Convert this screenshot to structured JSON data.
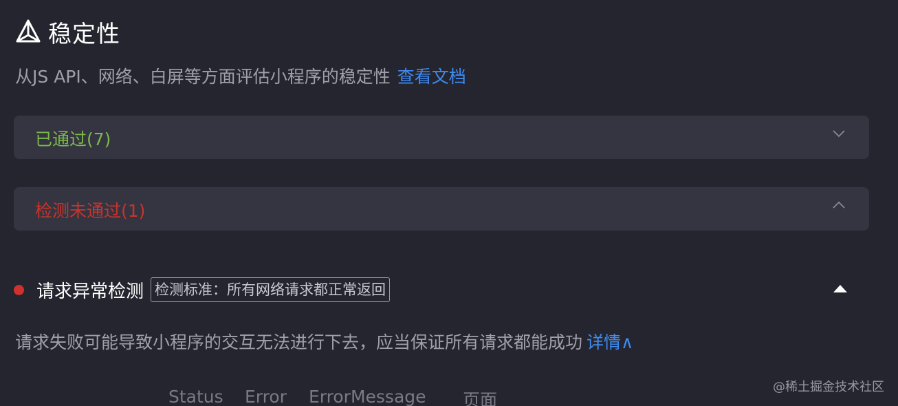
{
  "section": {
    "title": "稳定性",
    "icon": "stability-icon",
    "description": "从JS API、网络、白屏等方面评估小程序的稳定性",
    "doc_link": "查看文档"
  },
  "panels": {
    "passed_label": "已通过(7)",
    "failed_label": "检测未通过(1)"
  },
  "check": {
    "title": "请求异常检测",
    "standard": "检测标准：所有网络请求都正常返回",
    "description": "请求失败可能导致小程序的交互无法进行下去，应当保证所有请求都能成功",
    "detail_link": "详情∧"
  },
  "table": {
    "columns": [
      "Status",
      "Error",
      "ErrorMessage",
      "页面"
    ]
  },
  "watermark": "@稀土掘金技术社区",
  "colors": {
    "background": "#25252f",
    "panel": "#353542",
    "pass": "#7cb84a",
    "fail": "#c8342c",
    "link": "#3f8cf2"
  }
}
